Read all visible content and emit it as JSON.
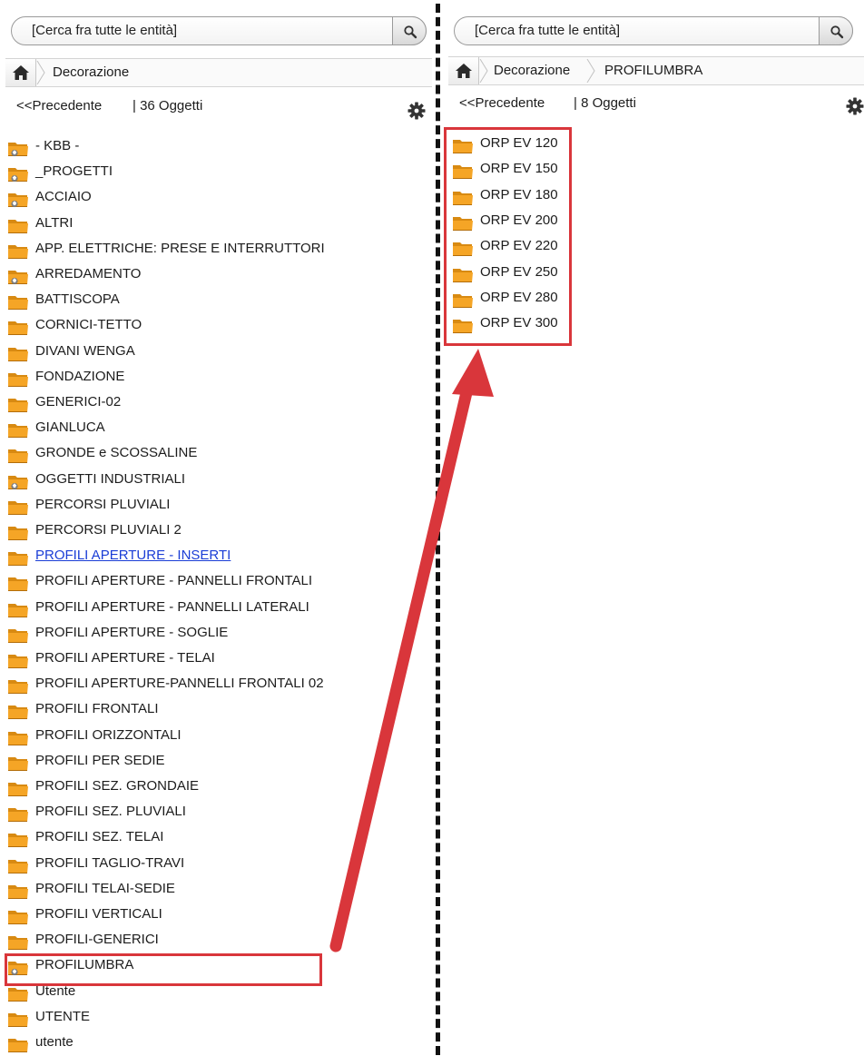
{
  "colors": {
    "accent_red": "#d9363b",
    "folder_orange": "#f5a526",
    "link_blue": "#1a3dd6"
  },
  "left_panel": {
    "search": {
      "placeholder": "[Cerca fra tutte le entità]",
      "icon": "magnifier-icon"
    },
    "breadcrumb": {
      "home_icon": "home-icon",
      "items": [
        "Decorazione"
      ]
    },
    "nav": {
      "prev_label": "<<Precedente",
      "count_label": "| 36 Oggetti",
      "settings_icon": "gear-icon"
    },
    "items": [
      {
        "label": "- KBB -",
        "icon": "folder-linked-icon",
        "style": "normal"
      },
      {
        "label": "_PROGETTI",
        "icon": "folder-linked-icon",
        "style": "normal"
      },
      {
        "label": "ACCIAIO",
        "icon": "folder-linked-icon",
        "style": "normal"
      },
      {
        "label": "ALTRI",
        "icon": "folder-icon",
        "style": "normal"
      },
      {
        "label": "APP. ELETTRICHE: PRESE E INTERRUTTORI",
        "icon": "folder-icon",
        "style": "normal"
      },
      {
        "label": "ARREDAMENTO",
        "icon": "folder-linked-icon",
        "style": "normal"
      },
      {
        "label": "BATTISCOPA",
        "icon": "folder-icon",
        "style": "normal"
      },
      {
        "label": "CORNICI-TETTO",
        "icon": "folder-icon",
        "style": "normal"
      },
      {
        "label": "DIVANI WENGA",
        "icon": "folder-icon",
        "style": "normal"
      },
      {
        "label": "FONDAZIONE",
        "icon": "folder-icon",
        "style": "normal"
      },
      {
        "label": "GENERICI-02",
        "icon": "folder-icon",
        "style": "normal"
      },
      {
        "label": "GIANLUCA",
        "icon": "folder-icon",
        "style": "normal"
      },
      {
        "label": "GRONDE e SCOSSALINE",
        "icon": "folder-icon",
        "style": "normal"
      },
      {
        "label": "OGGETTI INDUSTRIALI",
        "icon": "folder-linked-icon",
        "style": "normal"
      },
      {
        "label": "PERCORSI PLUVIALI",
        "icon": "folder-icon",
        "style": "normal"
      },
      {
        "label": "PERCORSI PLUVIALI 2",
        "icon": "folder-icon",
        "style": "normal"
      },
      {
        "label": "PROFILI APERTURE - INSERTI",
        "icon": "folder-icon",
        "style": "link"
      },
      {
        "label": "PROFILI APERTURE - PANNELLI FRONTALI",
        "icon": "folder-icon",
        "style": "normal"
      },
      {
        "label": "PROFILI APERTURE - PANNELLI LATERALI",
        "icon": "folder-icon",
        "style": "normal"
      },
      {
        "label": "PROFILI APERTURE - SOGLIE",
        "icon": "folder-icon",
        "style": "normal"
      },
      {
        "label": "PROFILI APERTURE - TELAI",
        "icon": "folder-icon",
        "style": "normal"
      },
      {
        "label": "PROFILI APERTURE-PANNELLI FRONTALI 02",
        "icon": "folder-icon",
        "style": "normal"
      },
      {
        "label": "PROFILI FRONTALI",
        "icon": "folder-icon",
        "style": "normal"
      },
      {
        "label": "PROFILI ORIZZONTALI",
        "icon": "folder-icon",
        "style": "normal"
      },
      {
        "label": "PROFILI PER SEDIE",
        "icon": "folder-icon",
        "style": "normal"
      },
      {
        "label": "PROFILI SEZ. GRONDAIE",
        "icon": "folder-icon",
        "style": "normal"
      },
      {
        "label": "PROFILI SEZ. PLUVIALI",
        "icon": "folder-icon",
        "style": "normal"
      },
      {
        "label": "PROFILI SEZ. TELAI",
        "icon": "folder-icon",
        "style": "normal"
      },
      {
        "label": "PROFILI TAGLIO-TRAVI",
        "icon": "folder-icon",
        "style": "normal"
      },
      {
        "label": "PROFILI TELAI-SEDIE",
        "icon": "folder-icon",
        "style": "normal"
      },
      {
        "label": "PROFILI VERTICALI",
        "icon": "folder-icon",
        "style": "normal"
      },
      {
        "label": "PROFILI-GENERICI",
        "icon": "folder-icon",
        "style": "normal"
      },
      {
        "label": "PROFILUMBRA",
        "icon": "folder-linked-icon",
        "style": "normal",
        "highlighted": true
      },
      {
        "label": "Utente",
        "icon": "folder-icon",
        "style": "normal"
      },
      {
        "label": "UTENTE",
        "icon": "folder-icon",
        "style": "normal"
      },
      {
        "label": "utente",
        "icon": "folder-icon",
        "style": "normal"
      }
    ]
  },
  "right_panel": {
    "search": {
      "placeholder": "[Cerca fra tutte le entità]",
      "icon": "magnifier-icon"
    },
    "breadcrumb": {
      "home_icon": "home-icon",
      "items": [
        "Decorazione",
        "PROFILUMBRA"
      ]
    },
    "nav": {
      "prev_label": "<<Precedente",
      "count_label": "| 8 Oggetti",
      "settings_icon": "gear-icon"
    },
    "items": [
      {
        "label": "ORP EV 120",
        "icon": "folder-icon"
      },
      {
        "label": "ORP EV 150",
        "icon": "folder-icon"
      },
      {
        "label": "ORP EV 180",
        "icon": "folder-icon"
      },
      {
        "label": "ORP EV 200",
        "icon": "folder-icon"
      },
      {
        "label": "ORP EV 220",
        "icon": "folder-icon"
      },
      {
        "label": "ORP EV 250",
        "icon": "folder-icon"
      },
      {
        "label": "ORP EV 280",
        "icon": "folder-icon"
      },
      {
        "label": "ORP EV 300",
        "icon": "folder-icon"
      }
    ],
    "highlighted": true
  },
  "annotation": {
    "arrow": "from PROFILUMBRA to right list",
    "icon": "arrow-icon"
  }
}
